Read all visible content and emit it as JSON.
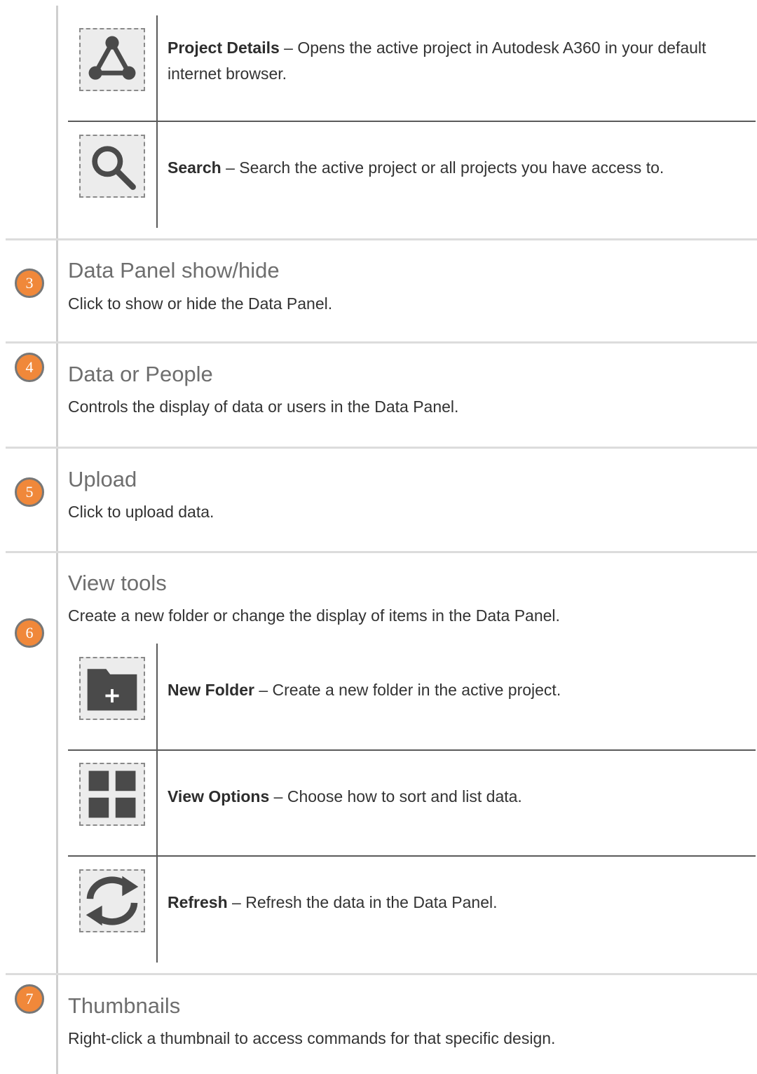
{
  "tools_top": [
    {
      "name": "Project Details",
      "desc": " – Opens the active project in Autodesk A360 in your default internet browser.",
      "icon": "project-details-icon"
    },
    {
      "name": "Search",
      "desc": " – Search the active project or all projects you have access to.",
      "icon": "search-icon"
    }
  ],
  "sections": {
    "s3": {
      "number": "3",
      "title": "Data Panel show/hide",
      "desc": "Click to show or hide the Data Panel."
    },
    "s4": {
      "number": "4",
      "title": "Data or People",
      "desc": "Controls the display of data or users in the Data Panel."
    },
    "s5": {
      "number": "5",
      "title": "Upload",
      "desc": "Click to upload data."
    },
    "s6": {
      "number": "6",
      "title": "View tools",
      "desc": "Create a new folder or change the display of items in the Data Panel."
    },
    "s7": {
      "number": "7",
      "title": "Thumbnails",
      "desc": "Right-click a thumbnail to access commands for that specific design."
    }
  },
  "view_tools": [
    {
      "name": "New Folder",
      "desc": " – Create a new folder in the active project.",
      "icon": "new-folder-icon"
    },
    {
      "name": "View Options",
      "desc": " – Choose how to sort and list data.",
      "icon": "grid-icon"
    },
    {
      "name": "Refresh",
      "desc": " – Refresh the data in the Data Panel.",
      "icon": "refresh-icon"
    }
  ],
  "colors": {
    "badge": "#f0883a",
    "badge_border": "#777777",
    "icon_fill": "#4a4a4a"
  }
}
